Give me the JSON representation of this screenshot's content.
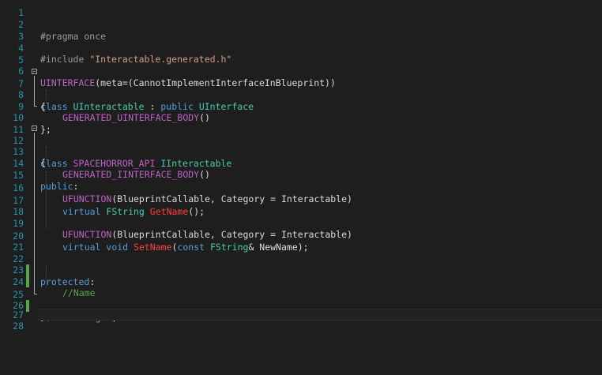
{
  "editor": {
    "line_numbers": [
      "1",
      "2",
      "3",
      "4",
      "5",
      "6",
      "7",
      "8",
      "9",
      "10",
      "11",
      "12",
      "13",
      "14",
      "15",
      "16",
      "17",
      "18",
      "19",
      "20",
      "21",
      "22",
      "23",
      "24",
      "25",
      "26",
      "27",
      "28"
    ],
    "lines": {
      "l2": {
        "pp": "#pragma once"
      },
      "l4": {
        "pp": "#include ",
        "str": "\"Interactable.generated.h\""
      },
      "l6": {
        "macro": "UINTERFACE",
        "rest": "(meta=(CannotImplementInterfaceInBlueprint))"
      },
      "l7": {
        "kw1": "class ",
        "type1": "UInteractable",
        "p1": " : ",
        "kw2": "public ",
        "type2": "UInterface"
      },
      "l8": {
        "text": "{"
      },
      "l9": {
        "macro": "GENERATED_UINTERFACE_BODY",
        "rest": "()"
      },
      "l10": {
        "text": "};"
      },
      "l12": {
        "kw1": "class ",
        "macro": "SPACEHORROR_API",
        "p1": " ",
        "type1": "IInteractable"
      },
      "l13": {
        "text": "{"
      },
      "l14": {
        "macro": "GENERATED_IINTERFACE_BODY",
        "rest": "()"
      },
      "l15": {
        "kw": "public",
        "rest": ":"
      },
      "l16": {
        "macro": "UFUNCTION",
        "rest": "(BlueprintCallable, Category = Interactable)"
      },
      "l17": {
        "kw": "virtual ",
        "type": "FString",
        "p1": " ",
        "fn": "GetName",
        "rest": "();"
      },
      "l19": {
        "macro": "UFUNCTION",
        "rest": "(BlueprintCallable, Category = Interactable)"
      },
      "l20": {
        "kw1": "virtual ",
        "kw2": "void ",
        "fn": "SetName",
        "p1": "(",
        "kw3": "const ",
        "type": "FString",
        "rest": "& NewName);"
      },
      "l22": {
        "kw": "protected",
        "rest": ":"
      },
      "l24": {
        "comment": "//Name"
      },
      "l25": {
        "type": "FString",
        "rest": " N;"
      },
      "l26": {
        "text": "};"
      }
    },
    "colors": {
      "background": "#1e1e1e",
      "line_number": "#2b91af",
      "keyword": "#569cd6",
      "type": "#4ec9b0",
      "macro": "#bd63c5",
      "string": "#d69d85",
      "comment": "#57a64a",
      "function_highlight": "#ff3f3f",
      "modified_marker": "#57a64a"
    }
  }
}
